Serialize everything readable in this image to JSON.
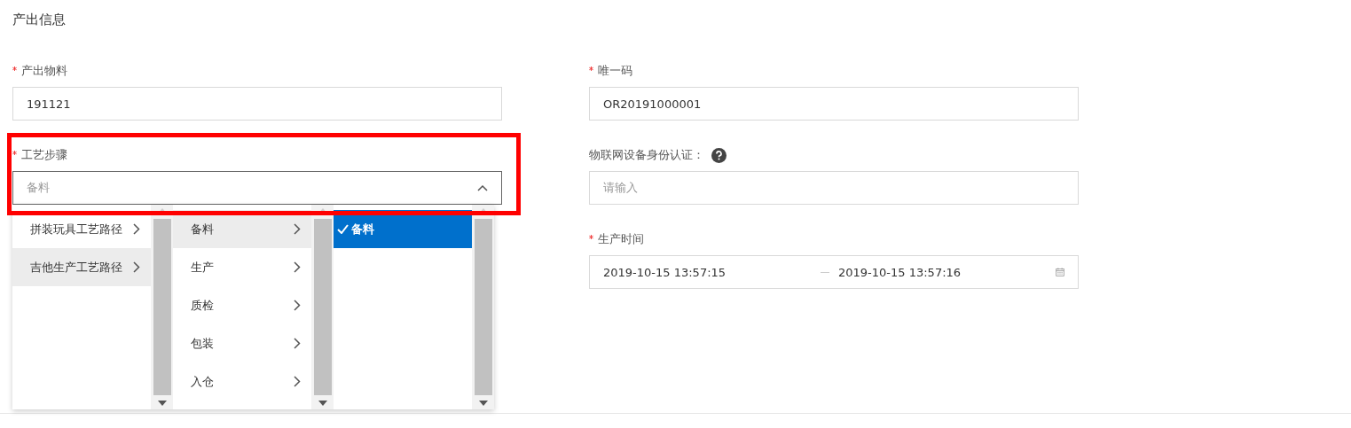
{
  "section_title": "产出信息",
  "left_fields": [
    {
      "kind": "text",
      "label": "产出物料",
      "required": true,
      "value": "191121"
    },
    {
      "kind": "cascader",
      "label": "工艺步骤",
      "required": true,
      "placeholder": "备料",
      "expanded": true,
      "menus": [
        {
          "items": [
            {
              "label": "拼装玩具工艺路径",
              "selected": false,
              "has_children": true
            },
            {
              "label": "吉他生产工艺路径",
              "selected": true,
              "has_children": true
            }
          ]
        },
        {
          "items": [
            {
              "label": "备料",
              "selected": true,
              "has_children": true
            },
            {
              "label": "生产",
              "selected": false,
              "has_children": true
            },
            {
              "label": "质检",
              "selected": false,
              "has_children": true
            },
            {
              "label": "包装",
              "selected": false,
              "has_children": true
            },
            {
              "label": "入仓",
              "selected": false,
              "has_children": true
            }
          ]
        },
        {
          "items": [
            {
              "label": "备料",
              "selected": true,
              "has_children": false
            }
          ]
        }
      ]
    }
  ],
  "right_fields": [
    {
      "kind": "text",
      "label": "唯一码",
      "required": true,
      "value": "OR20191000001"
    },
    {
      "kind": "placeholder",
      "label": "物联网设备身份认证：",
      "required": false,
      "help": true,
      "placeholder": "请输入"
    },
    {
      "kind": "daterange",
      "label": "生产时间",
      "required": true,
      "start": "2019-10-15 13:57:15",
      "end": "2019-10-15 13:57:16"
    }
  ],
  "highlight": true
}
